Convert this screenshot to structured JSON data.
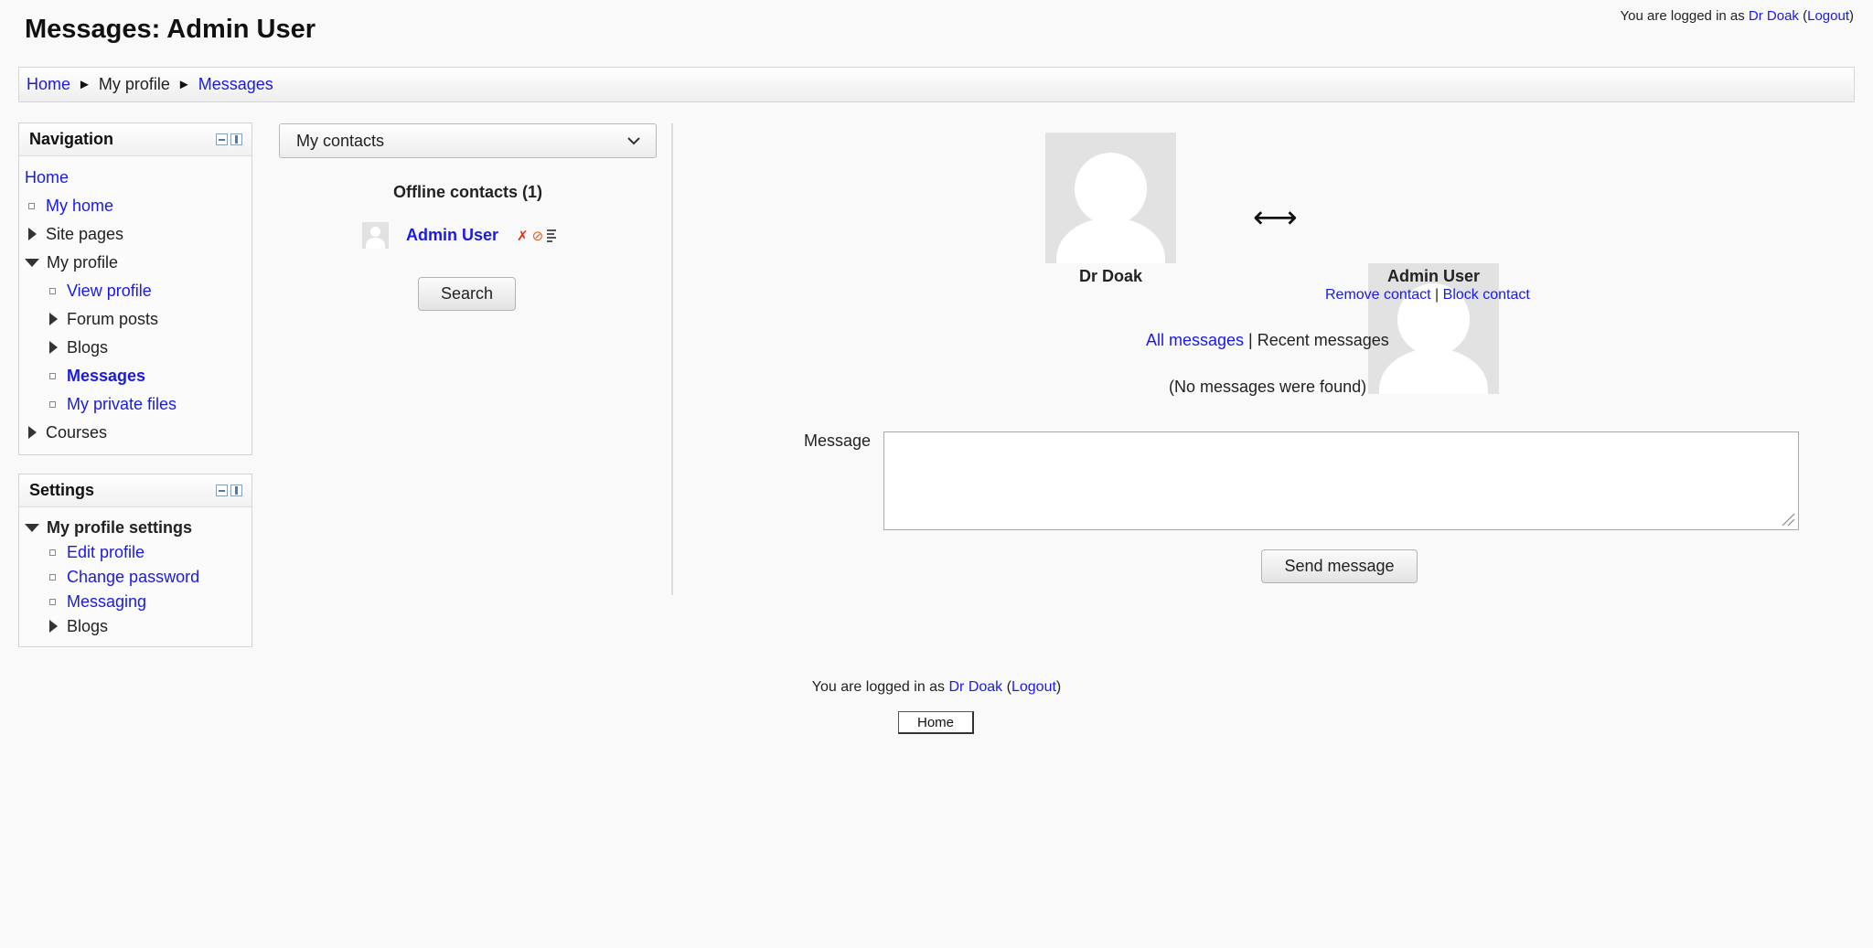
{
  "header": {
    "title": "Messages: Admin User",
    "login_prefix": "You are logged in as ",
    "user_name": "Dr Doak",
    "logout_label": "Logout"
  },
  "breadcrumb": {
    "items": [
      "Home",
      "My profile",
      "Messages"
    ],
    "separator": "►"
  },
  "navigation": {
    "title": "Navigation",
    "home": "Home",
    "my_home": "My home",
    "site_pages": "Site pages",
    "my_profile": "My profile",
    "view_profile": "View profile",
    "forum_posts": "Forum posts",
    "blogs": "Blogs",
    "messages": "Messages",
    "my_private_files": "My private files",
    "courses": "Courses"
  },
  "settings": {
    "title": "Settings",
    "my_profile_settings": "My profile settings",
    "edit_profile": "Edit profile",
    "change_password": "Change password",
    "messaging": "Messaging",
    "blogs": "Blogs"
  },
  "contacts": {
    "view_selected": "My contacts",
    "offline_heading": "Offline contacts (1)",
    "contact_name": "Admin User",
    "search_label": "Search"
  },
  "conversation": {
    "me_name": "Dr Doak",
    "them_name": "Admin User",
    "arrow": "⟷",
    "remove_contact": "Remove contact",
    "block_contact": "Block contact",
    "link_separator": " | ",
    "all_messages": "All messages",
    "recent_messages": "Recent messages",
    "no_messages": "(No messages were found)",
    "message_label": "Message",
    "message_value": "",
    "send_label": "Send message"
  },
  "footer": {
    "home_button": "Home"
  },
  "colors": {
    "link": "#1a1ae6",
    "remove_icon": "#e0301e",
    "block_icon": "#e0601e"
  }
}
